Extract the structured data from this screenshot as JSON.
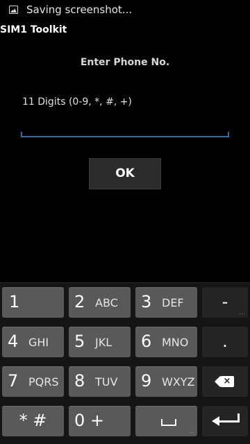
{
  "status_bar": {
    "icon": "image-icon",
    "notification_text": "Saving screenshot..."
  },
  "app": {
    "title": "SIM1 Toolkit"
  },
  "dialog": {
    "prompt": "Enter Phone No.",
    "hint": "11 Digits (0-9, *, #, +)",
    "input_value": "",
    "ok_label": "OK"
  },
  "keypad": {
    "k1": {
      "num": "1",
      "letters": ""
    },
    "k2": {
      "num": "2",
      "letters": "ABC"
    },
    "k3": {
      "num": "3",
      "letters": "DEF"
    },
    "k4": {
      "num": "4",
      "letters": "GHI"
    },
    "k5": {
      "num": "5",
      "letters": "JKL"
    },
    "k6": {
      "num": "6",
      "letters": "MNO"
    },
    "k7": {
      "num": "7",
      "letters": "PQRS"
    },
    "k8": {
      "num": "8",
      "letters": "TUV"
    },
    "k9": {
      "num": "9",
      "letters": "WXYZ"
    },
    "kstar": {
      "label": "* #"
    },
    "k0": {
      "label": "0 +"
    },
    "minus": "-",
    "period": ".",
    "more_dots": "..."
  },
  "icons": {
    "backspace": "backspace-icon",
    "space": "space-bar-icon",
    "enter": "enter-arrow-icon"
  },
  "colors": {
    "input_underline": "#2e6fa6",
    "key_bg": "#595959",
    "function_key_bg": "#252525"
  }
}
